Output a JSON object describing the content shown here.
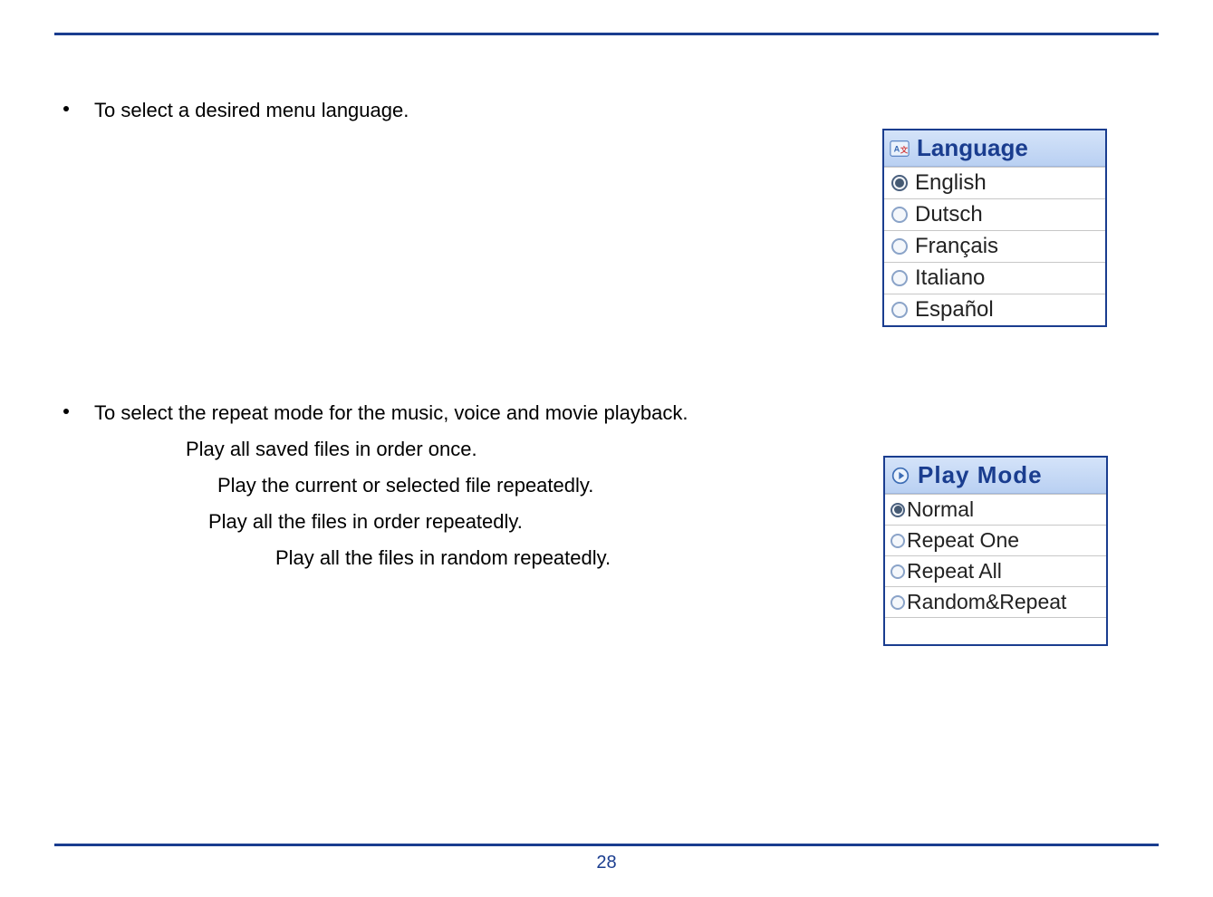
{
  "page_number": "28",
  "section_language": {
    "bullet_text": "To select a desired menu language.",
    "panel": {
      "title": "Language",
      "options": [
        {
          "label": "English",
          "selected": true
        },
        {
          "label": "Dutsch",
          "selected": false
        },
        {
          "label": "Français",
          "selected": false
        },
        {
          "label": "Italiano",
          "selected": false
        },
        {
          "label": "Español",
          "selected": false
        }
      ]
    }
  },
  "section_playmode": {
    "bullet_text": "To select the repeat mode for the music, voice and movie playback.",
    "sublines": [
      "Play all saved files in order once.",
      "Play the current or selected file repeatedly.",
      "Play all the files in order repeatedly.",
      "Play all the files in random repeatedly."
    ],
    "panel": {
      "title": "Play Mode",
      "options": [
        {
          "label": "Normal",
          "selected": true
        },
        {
          "label": "Repeat One",
          "selected": false
        },
        {
          "label": "Repeat All",
          "selected": false
        },
        {
          "label": "Random&Repeat",
          "selected": false
        }
      ]
    }
  }
}
